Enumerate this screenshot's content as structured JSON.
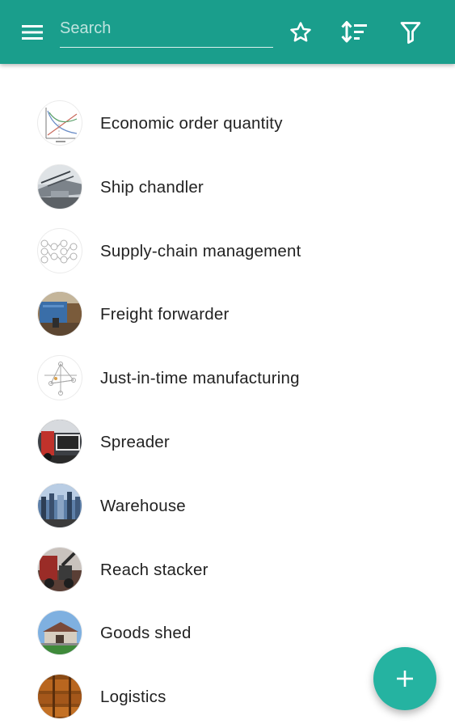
{
  "toolbar": {
    "menu_icon": "menu-icon",
    "search_placeholder": "Search",
    "favorites_icon": "star-outline-icon",
    "sort_icon": "sort-icon",
    "filter_icon": "filter-icon",
    "color": "#1a9e8c"
  },
  "list": {
    "items": [
      {
        "label": "Economic order quantity",
        "thumbnail": "eoq-chart-thumbnail"
      },
      {
        "label": "Ship chandler",
        "thumbnail": "ship-chandler-thumbnail"
      },
      {
        "label": "Supply-chain management",
        "thumbnail": "supply-chain-diagram-thumbnail"
      },
      {
        "label": "Freight forwarder",
        "thumbnail": "freight-forwarder-thumbnail"
      },
      {
        "label": "Just-in-time manufacturing",
        "thumbnail": "jit-diagram-thumbnail"
      },
      {
        "label": "Spreader",
        "thumbnail": "spreader-thumbnail"
      },
      {
        "label": "Warehouse",
        "thumbnail": "warehouse-thumbnail"
      },
      {
        "label": "Reach stacker",
        "thumbnail": "reach-stacker-thumbnail"
      },
      {
        "label": "Goods shed",
        "thumbnail": "goods-shed-thumbnail"
      },
      {
        "label": "Logistics",
        "thumbnail": "logistics-thumbnail"
      }
    ]
  },
  "fab": {
    "icon": "plus-icon",
    "color": "#25b3a1"
  }
}
